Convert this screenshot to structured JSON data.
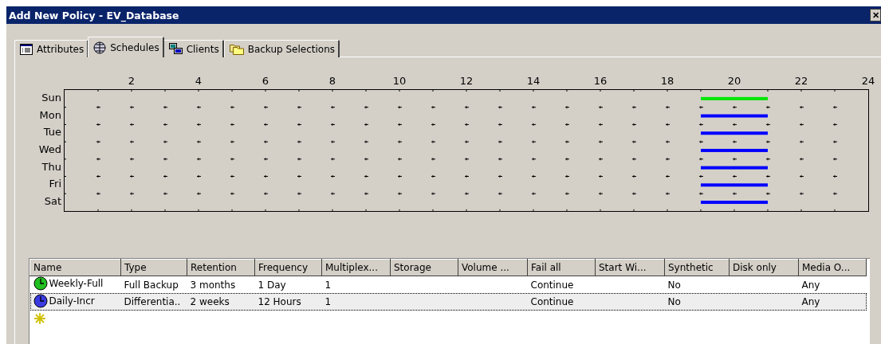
{
  "window": {
    "title": "Add New Policy - EV_Database",
    "close_button": "✕"
  },
  "tabs": [
    {
      "label": "Attributes",
      "selected": false
    },
    {
      "label": "Schedules",
      "selected": true
    },
    {
      "label": "Clients",
      "selected": false
    },
    {
      "label": "Backup Selections",
      "selected": false
    }
  ],
  "schedule": {
    "hour_labels": [
      "2",
      "4",
      "6",
      "8",
      "10",
      "12",
      "14",
      "16",
      "18",
      "20",
      "22",
      "24"
    ],
    "days": [
      {
        "label": "Sun",
        "windows": [
          {
            "color": "#00e600"
          }
        ]
      },
      {
        "label": "Mon",
        "windows": [
          {
            "color": "#0000ff"
          }
        ]
      },
      {
        "label": "Tue",
        "windows": [
          {
            "color": "#0000ff"
          }
        ]
      },
      {
        "label": "Wed",
        "windows": [
          {
            "color": "#0000ff"
          }
        ]
      },
      {
        "label": "Thu",
        "windows": [
          {
            "color": "#0000ff"
          }
        ]
      },
      {
        "label": "Fri",
        "windows": [
          {
            "color": "#0000ff"
          }
        ]
      },
      {
        "label": "Sat",
        "windows": [
          {
            "color": "#0000ff"
          }
        ]
      }
    ]
  },
  "table": {
    "columns": [
      "Name",
      "Type",
      "Retention",
      "Frequency",
      "Multiplex...",
      "Storage",
      "Volume ...",
      "Fail all",
      "Start Wi...",
      "Synthetic",
      "Disk only",
      "Media O..."
    ],
    "rows": [
      {
        "kind": "schedule",
        "color": "#22c022",
        "selected": false,
        "cells": [
          "Weekly-Full",
          "Full Backup",
          "3 months",
          "1 Day",
          "1",
          "",
          "",
          "Continue",
          "",
          "No",
          "",
          "Any"
        ]
      },
      {
        "kind": "schedule",
        "color": "#3a3ae0",
        "selected": true,
        "cells": [
          "Daily-Incr",
          "Differentia..",
          "2 weeks",
          "12 Hours",
          "1",
          "",
          "",
          "Continue",
          "",
          "No",
          "",
          "Any"
        ]
      },
      {
        "kind": "new",
        "selected": false
      }
    ]
  }
}
